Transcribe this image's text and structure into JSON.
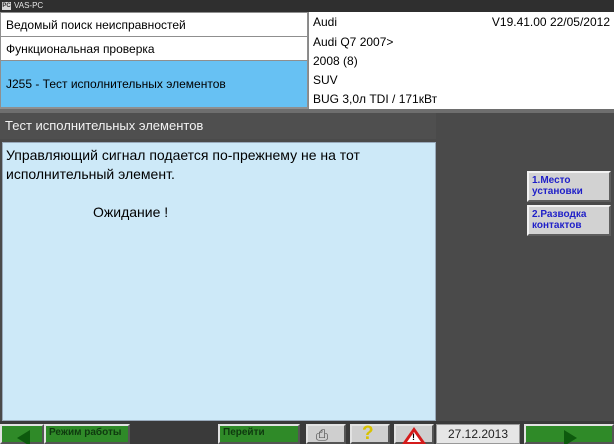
{
  "window": {
    "title": "VAS-PC",
    "app_icon_text": "PC"
  },
  "header": {
    "left": {
      "rows": [
        "Ведомый поиск неисправностей",
        "Функциональная проверка",
        "J255 - Тест исполнительных элементов"
      ]
    },
    "right": {
      "make": "Audi",
      "version": "V19.41.00 22/05/2012",
      "model": "Audi Q7 2007>",
      "year": "2008 (8)",
      "body": "SUV",
      "engine": "BUG 3,0л TDI / 171кВт"
    }
  },
  "section": {
    "title": "Тест исполнительных элементов"
  },
  "content": {
    "message": "Управляющий сигнал подается по-прежнему не на тот исполнительный элемент.",
    "status": "Ожидание !"
  },
  "side_buttons": [
    {
      "label": "1.Место установки"
    },
    {
      "label": "2.Разводка контактов"
    }
  ],
  "bottom": {
    "mode_label": "Режим работы",
    "goto_label": "Перейти",
    "help_glyph": "?",
    "warning_mark": "!",
    "date": "27.12.2013"
  },
  "colors": {
    "selected_row": "#67c1f3",
    "content_bg": "#cde9f8",
    "button_text": "#1f1fc8",
    "nav_green": "#2f8a28",
    "warning_red": "#d41b1b",
    "help_yellow": "#d8c200"
  }
}
